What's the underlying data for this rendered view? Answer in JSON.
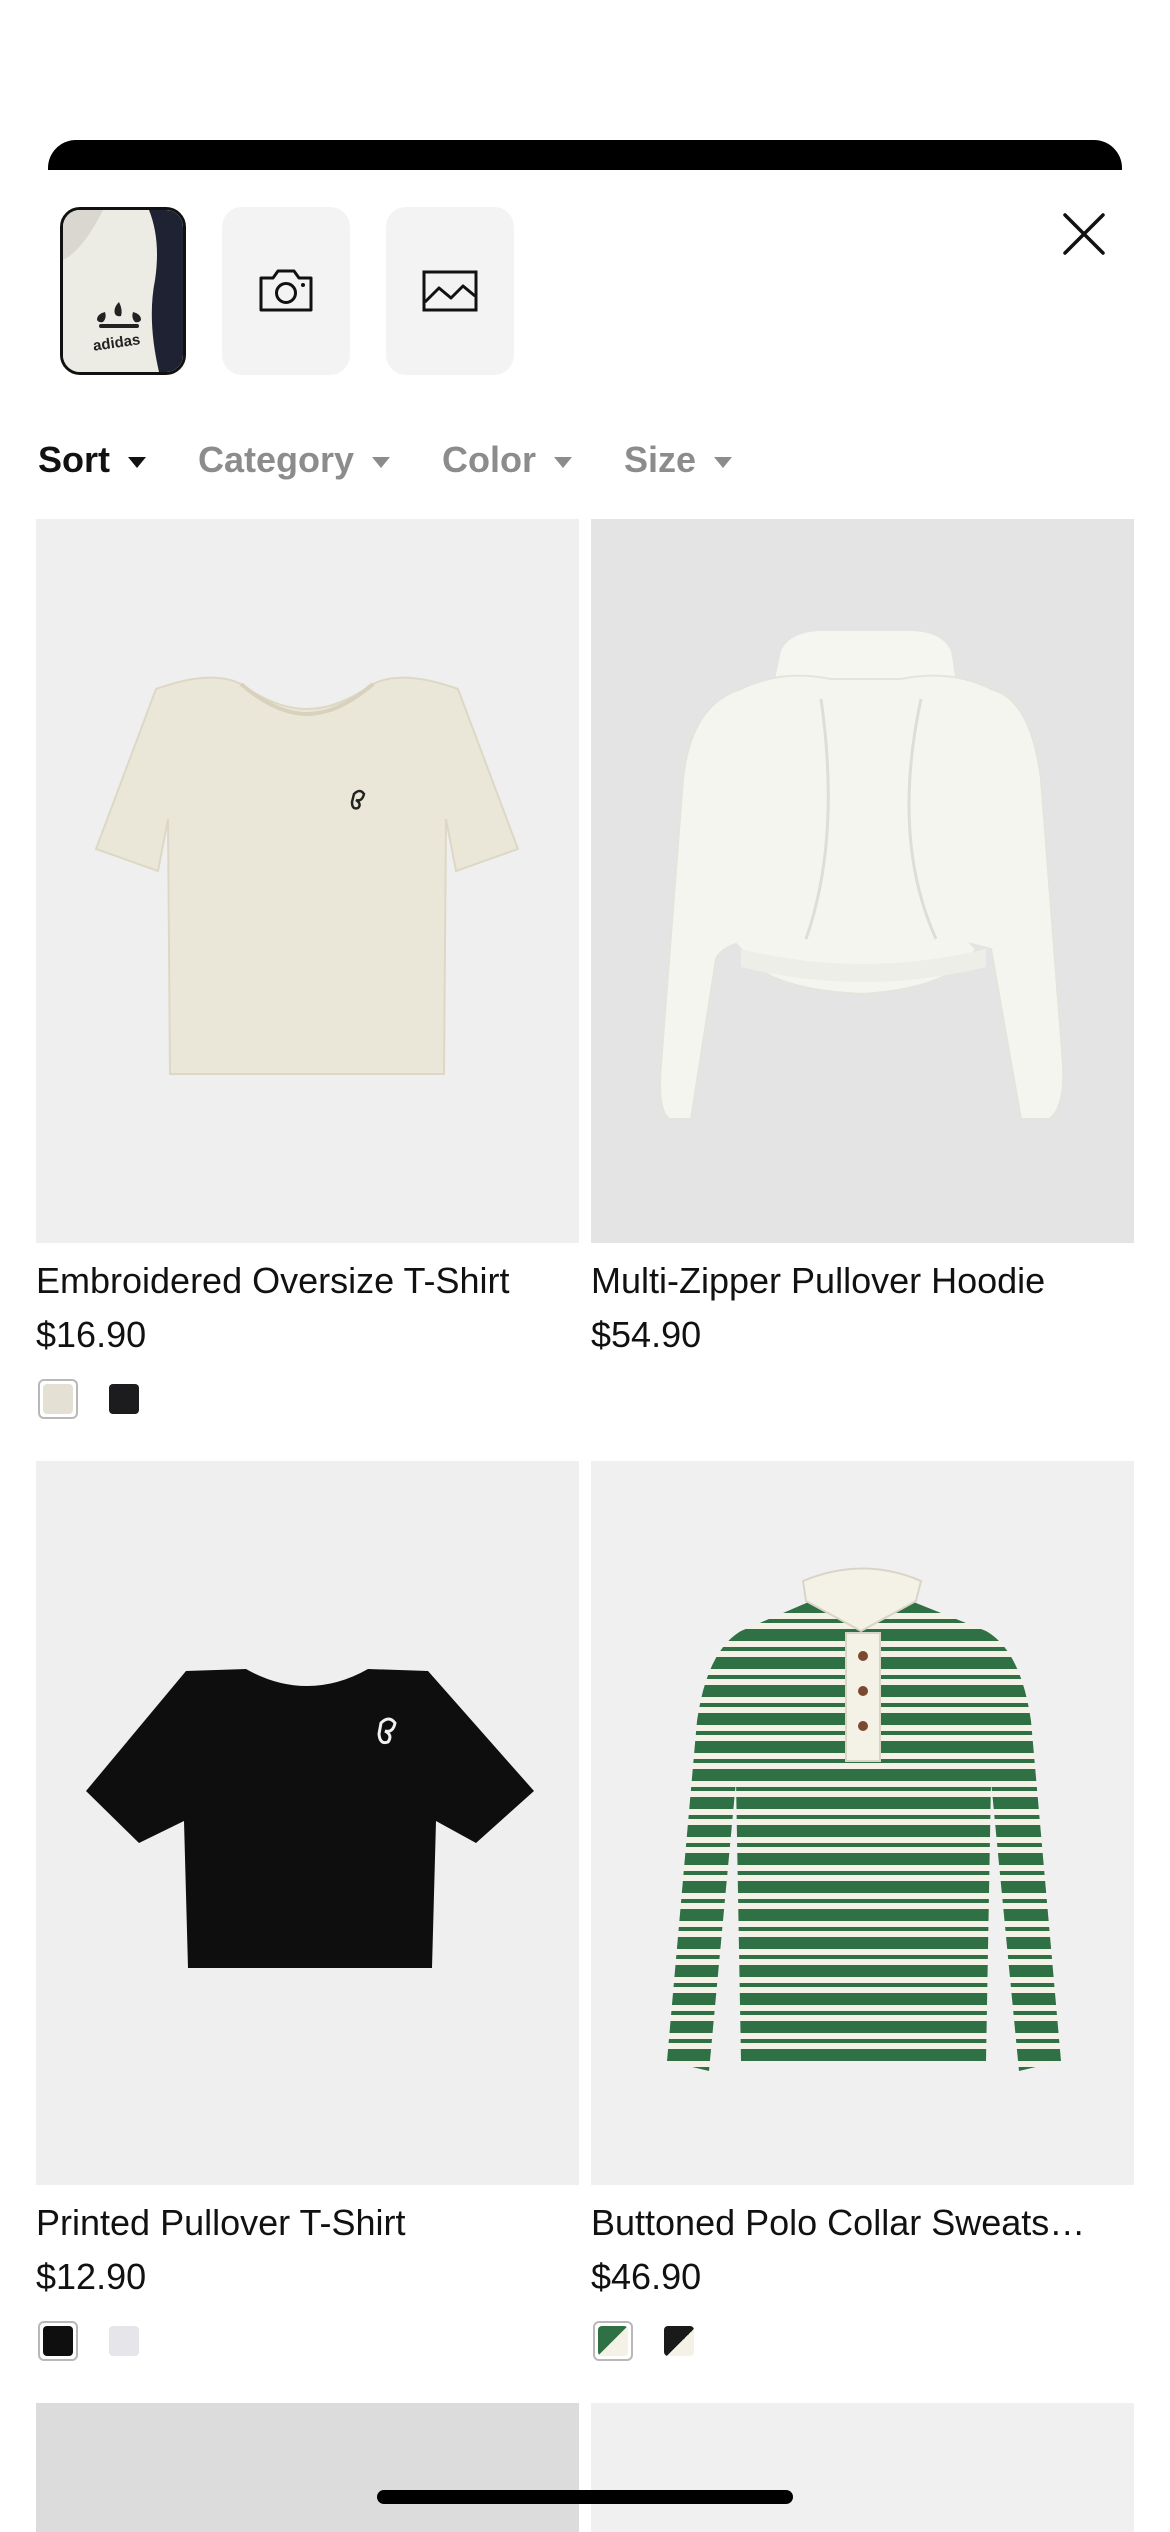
{
  "source_images": {
    "selected_thumb_text": "adidas",
    "camera_icon": "camera-icon",
    "gallery_icon": "image-icon"
  },
  "close_icon": "close-icon",
  "filters": [
    {
      "label": "Sort",
      "active": true
    },
    {
      "label": "Category",
      "active": false
    },
    {
      "label": "Color",
      "active": false
    },
    {
      "label": "Size",
      "active": false
    }
  ],
  "products": [
    {
      "title": "Embroidered Oversize T-Shirt",
      "price": "$16.90",
      "bg": "#efefef",
      "swatches": [
        "#e4e1d4",
        "#1c1c1e"
      ]
    },
    {
      "title": "Multi-Zipper Pullover Hoodie",
      "price": "$54.90",
      "bg": "#e4e4e4",
      "swatches": []
    },
    {
      "title": "Printed Pullover T-Shirt",
      "price": "$12.90",
      "bg": "#efefef",
      "swatches": [
        "#0f0f0f",
        "#e6e6ea"
      ]
    },
    {
      "title": "Buttoned Polo Collar Sweats…",
      "price": "$46.90",
      "bg": "#f0f0f0",
      "swatches": [
        "#2f7044",
        "#1a1a1a"
      ]
    }
  ],
  "colors": {
    "accent": "#000000",
    "muted_text": "#8c8c8c",
    "tile_bg": "#f3f3f3"
  }
}
